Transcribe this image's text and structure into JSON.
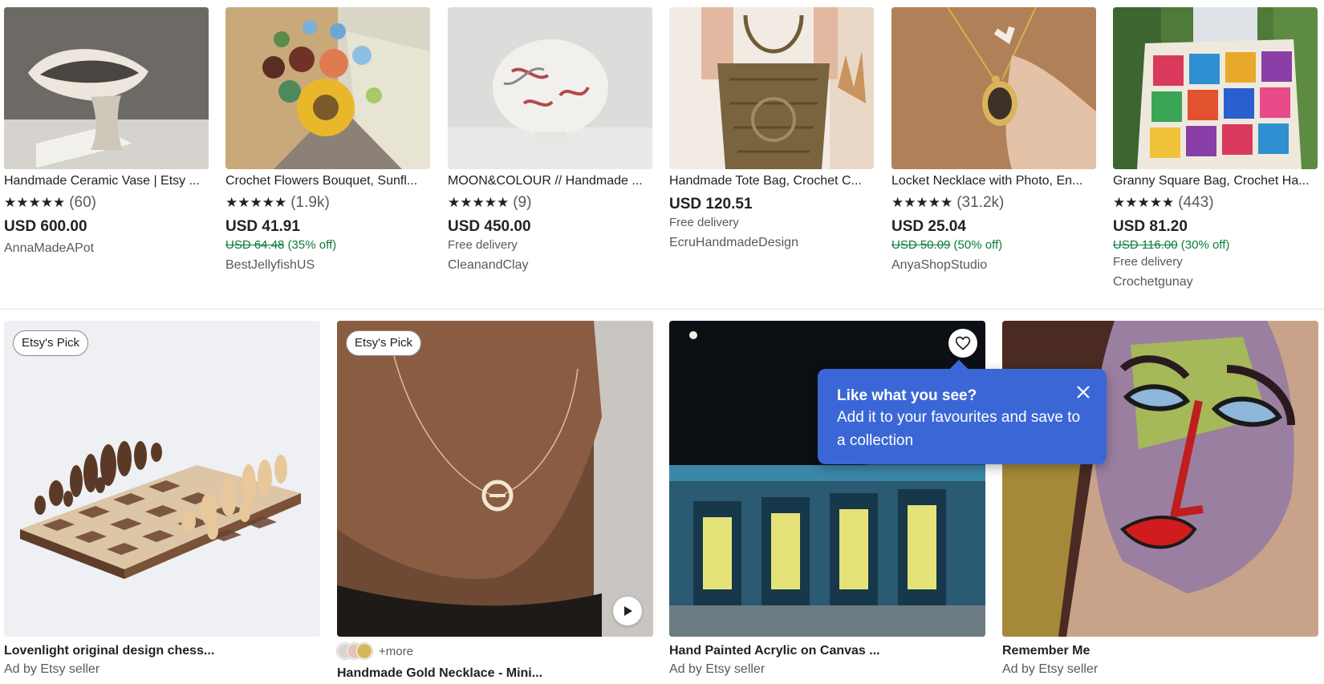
{
  "row1": [
    {
      "title": "Handmade Ceramic Vase | Etsy ...",
      "stars": "★★★★★",
      "reviews": "(60)",
      "price": "USD 600.00",
      "original_price": "",
      "discount": "",
      "delivery": "",
      "shop": "AnnaMadeAPot"
    },
    {
      "title": "Crochet Flowers Bouquet, Sunfl...",
      "stars": "★★★★★",
      "reviews": "(1.9k)",
      "price": "USD 41.91",
      "original_price": "USD 64.48",
      "discount": "(35% off)",
      "delivery": "",
      "shop": "BestJellyfishUS"
    },
    {
      "title": "MOON&COLOUR // Handmade ...",
      "stars": "★★★★★",
      "reviews": "(9)",
      "price": "USD 450.00",
      "original_price": "",
      "discount": "",
      "delivery": "Free delivery",
      "shop": "CleanandClay"
    },
    {
      "title": "Handmade Tote Bag, Crochet C...",
      "stars": "",
      "reviews": "",
      "price": "USD 120.51",
      "original_price": "",
      "discount": "",
      "delivery": "Free delivery",
      "shop": "EcruHandmadeDesign"
    },
    {
      "title": "Locket Necklace with Photo, En...",
      "stars": "★★★★★",
      "reviews": "(31.2k)",
      "price": "USD 25.04",
      "original_price": "USD 50.09",
      "discount": "(50% off)",
      "delivery": "",
      "shop": "AnyaShopStudio"
    },
    {
      "title": "Granny Square Bag, Crochet Ha...",
      "stars": "★★★★★",
      "reviews": "(443)",
      "price": "USD 81.20",
      "original_price": "USD 116.00",
      "discount": "(30% off)",
      "delivery": "Free delivery",
      "shop": "Crochetgunay"
    }
  ],
  "row2": [
    {
      "badge": "Etsy's Pick",
      "title": "Lovenlight original design chess...",
      "sub": "Ad by Etsy seller"
    },
    {
      "badge": "Etsy's Pick",
      "more": "+more",
      "title": "Handmade Gold Necklace - Mini..."
    },
    {
      "title": "Hand Painted Acrylic on Canvas ...",
      "sub": "Ad by Etsy seller"
    },
    {
      "title": "Remember Me",
      "sub": "Ad by Etsy seller"
    }
  ],
  "tooltip": {
    "heading": "Like what you see?",
    "body": "Add it to your favourites and save to a collection"
  },
  "icons": {
    "star": "star-icon",
    "heart": "heart-icon",
    "play": "play-icon",
    "close": "close-icon"
  },
  "colors": {
    "discount_green": "#0e7a3d",
    "tooltip_blue": "#3b67d6",
    "swatch_1": "#d9d6d2",
    "swatch_2": "#e6c4b9",
    "swatch_3": "#d8b65a"
  }
}
